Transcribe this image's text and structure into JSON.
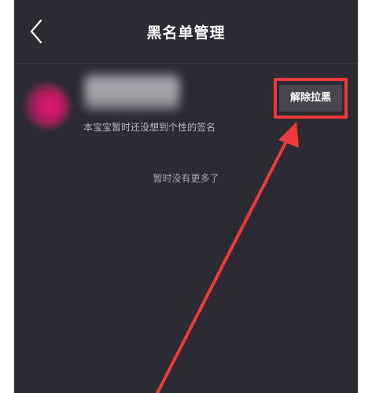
{
  "header": {
    "title": "黑名单管理",
    "back_icon": "chevron-left-icon"
  },
  "blocked_list": [
    {
      "signature": "本宝宝暂时还没想到个性的签名",
      "action_label": "解除拉黑"
    }
  ],
  "empty_message": "暂时没有更多了",
  "annotation": {
    "color": "#ee3a3a"
  }
}
